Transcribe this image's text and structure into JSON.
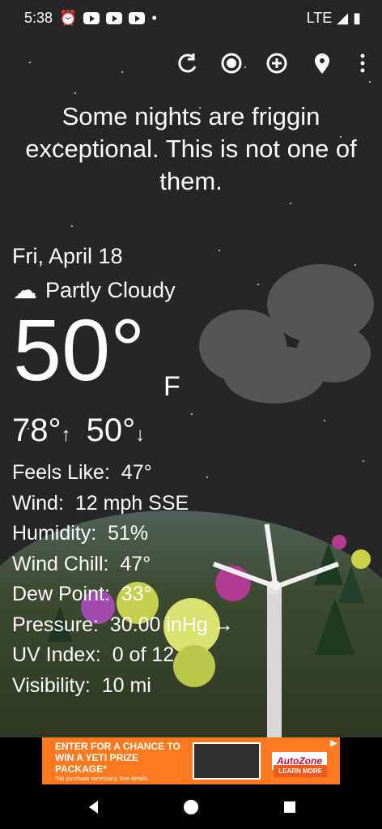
{
  "status_bar": {
    "time": "5:38",
    "network": "LTE"
  },
  "toolbar": {
    "refresh_icon": "refresh-icon",
    "moon_icon": "moon-phase-icon",
    "add_icon": "add-location-icon",
    "location_icon": "location-pin-icon",
    "menu_icon": "more-options-icon"
  },
  "quote": "Some nights are friggin exceptional. This is not one of them.",
  "weather": {
    "date": "Fri, April 18",
    "condition": "Partly Cloudy",
    "temperature": "50°",
    "unit": "F",
    "high": "78°",
    "low": "50°",
    "feels_like": {
      "label": "Feels Like:",
      "value": "47°"
    },
    "wind": {
      "label": "Wind:",
      "value": "12 mph SSE"
    },
    "humidity": {
      "label": "Humidity:",
      "value": "51%"
    },
    "wind_chill": {
      "label": "Wind Chill:",
      "value": "47°"
    },
    "dew_point": {
      "label": "Dew Point:",
      "value": "33°"
    },
    "pressure": {
      "label": "Pressure:",
      "value": "30.00 inHg"
    },
    "uv_index": {
      "label": "UV Index:",
      "value": "0 of 12"
    },
    "visibility": {
      "label": "Visibility:",
      "value": "10 mi"
    }
  },
  "ad": {
    "headline": "ENTER FOR A CHANCE TO WIN A YETI PRIZE PACKAGE*",
    "fine_print": "*No purchase necessary. See details.",
    "brand": "AutoZone",
    "cta": "LEARN MORE"
  }
}
